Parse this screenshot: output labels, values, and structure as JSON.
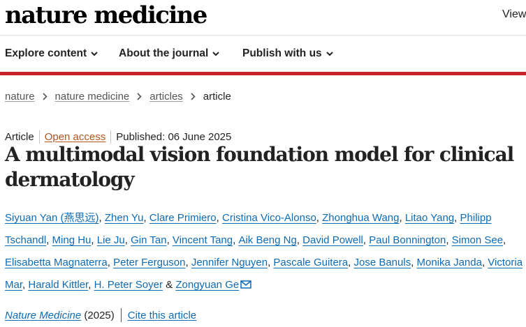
{
  "header": {
    "logo": "nature medicine",
    "view_link": "View"
  },
  "nav": {
    "items": [
      "Explore content",
      "About the journal",
      "Publish with us"
    ]
  },
  "breadcrumbs": {
    "items": [
      "nature",
      "nature medicine",
      "articles"
    ],
    "current": "article"
  },
  "meta": {
    "type": "Article",
    "access": "Open access",
    "published": "Published: 06 June 2025"
  },
  "title": "A multimodal vision foundation model for clinical dermatology",
  "authors": [
    "Siyuan Yan (燕思远)",
    "Zhen Yu",
    "Clare Primiero",
    "Cristina Vico-Alonso",
    "Zhonghua Wang",
    "Litao Yang",
    "Philipp Tschandl",
    "Ming Hu",
    "Lie Ju",
    "Gin Tan",
    "Vincent Tang",
    "Aik Beng Ng",
    "David Powell",
    "Paul Bonnington",
    "Simon See",
    "Elisabetta Magnaterra",
    "Peter Ferguson",
    "Jennifer Nguyen",
    "Pascale Guitera",
    "Jose Banuls",
    "Monika Janda",
    "Victoria Mar",
    "Harald Kittler",
    "H. Peter Soyer",
    "Zongyuan Ge"
  ],
  "authors_conjunction": "&",
  "citation": {
    "journal": "Nature Medicine",
    "year": "(2025)",
    "cite_label": "Cite this article"
  },
  "colors": {
    "accent_red": "#c6222b",
    "link_blue": "#0e6bb5",
    "open_access_orange": "#b3541e"
  },
  "icons": {
    "nav_caret": "chevron-down-icon",
    "breadcrumb_separator": "chevron-right-icon",
    "corresponding_author": "envelope-icon"
  }
}
